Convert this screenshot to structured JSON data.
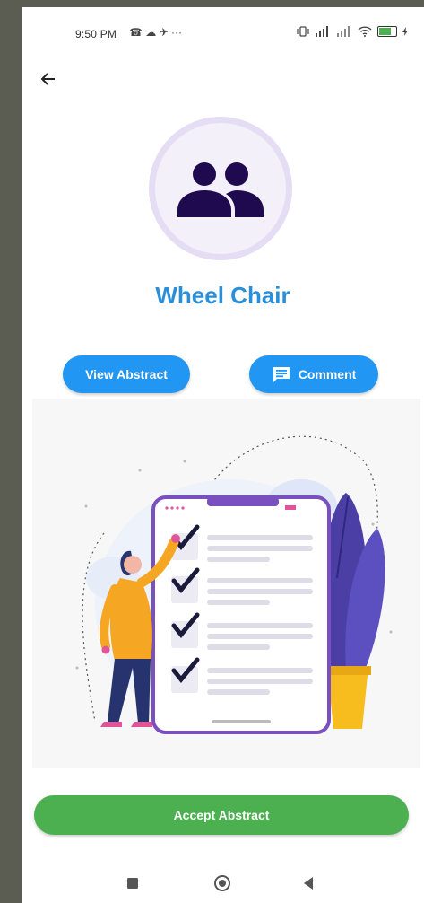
{
  "status_bar": {
    "time": "9:50 PM",
    "left_icons": "☎ ☁ ✈ ···",
    "right_icons": [
      "vibrate-icon",
      "signal-icon",
      "signal-icon",
      "wifi-icon",
      "battery-icon"
    ]
  },
  "header": {
    "back_icon": "arrow-left-icon"
  },
  "profile": {
    "icon": "group-icon",
    "title": "Wheel Chair"
  },
  "actions": {
    "view_abstract": "View Abstract",
    "comment": "Comment",
    "comment_icon": "comment-icon"
  },
  "footer": {
    "accept_label": "Accept Abstract"
  },
  "nav": {
    "items": [
      "square-icon",
      "circle-icon",
      "triangle-back-icon"
    ]
  },
  "colors": {
    "primary": "#2196f3",
    "title": "#2a8fd8",
    "accept": "#4caf50",
    "avatar_icon": "#1f0a4f"
  }
}
